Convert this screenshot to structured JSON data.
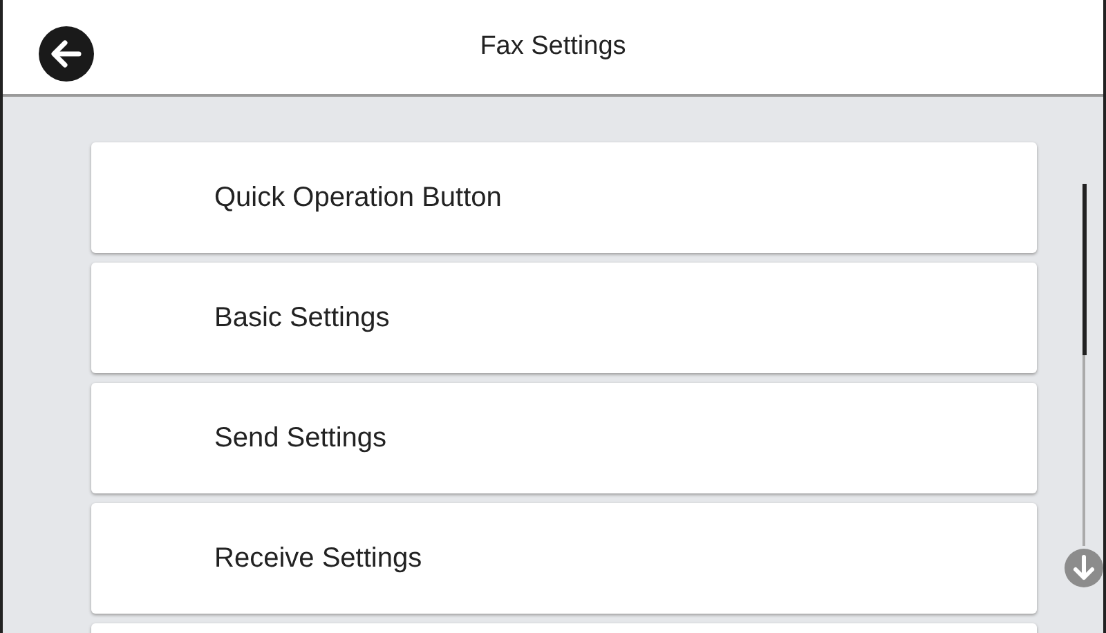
{
  "header": {
    "title": "Fax Settings"
  },
  "menu_items": [
    {
      "label": "Quick Operation Button"
    },
    {
      "label": "Basic Settings"
    },
    {
      "label": "Send Settings"
    },
    {
      "label": "Receive Settings"
    }
  ]
}
